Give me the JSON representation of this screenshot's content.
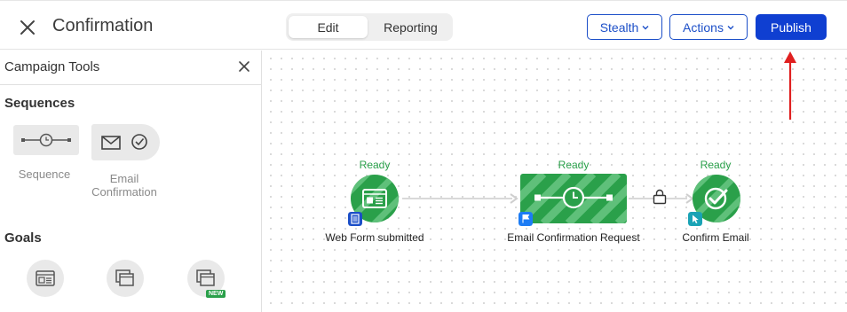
{
  "header": {
    "title": "Confirmation",
    "tabs": [
      {
        "label": "Edit",
        "active": true
      },
      {
        "label": "Reporting",
        "active": false
      }
    ],
    "stealth_label": "Stealth",
    "actions_label": "Actions",
    "publish_label": "Publish"
  },
  "sidebar": {
    "title": "Campaign Tools",
    "sequences_heading": "Sequences",
    "tools": [
      {
        "label": "Sequence",
        "icon": "sequence-icon"
      },
      {
        "label": "Email Confirmation",
        "icon": "email-confirmation-icon"
      }
    ],
    "goals_heading": "Goals",
    "goals": [
      {
        "icon": "web-form-icon"
      },
      {
        "icon": "landing-page-icon"
      },
      {
        "icon": "new-goal-icon",
        "badge": "NEW"
      }
    ]
  },
  "flow": {
    "nodes": [
      {
        "status": "Ready",
        "label": "Web Form submitted",
        "icon": "web-form-icon"
      },
      {
        "status": "Ready",
        "label": "Email Confirmation Request",
        "icon": "sequence-clock-icon"
      },
      {
        "status": "Ready",
        "label": "Confirm Email",
        "icon": "check-circle-icon"
      }
    ]
  },
  "colors": {
    "accent_blue": "#1c4fc8",
    "publish_blue": "#0f3fd1",
    "ready_green": "#2aa04a",
    "annotation_red": "#e02020"
  }
}
